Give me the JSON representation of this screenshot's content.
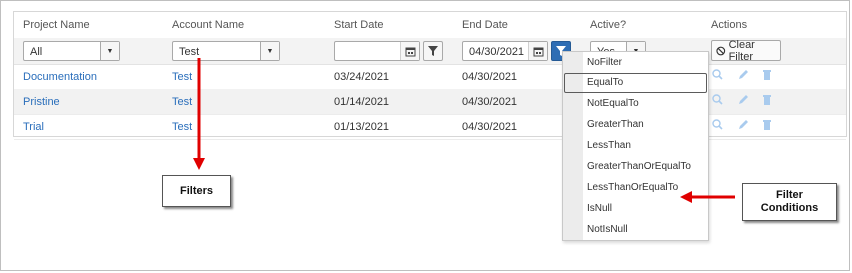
{
  "headers": {
    "project_name": "Project Name",
    "account_name": "Account Name",
    "start_date": "Start Date",
    "end_date": "End Date",
    "active": "Active?",
    "actions": "Actions"
  },
  "filters": {
    "project_value": "All",
    "account_value": "Test",
    "start_date_value": "",
    "end_date_value": "04/30/2021",
    "active_value": "Yes",
    "clear_filter_label": "Clear Filter"
  },
  "rows": [
    {
      "project": "Documentation",
      "account": "Test",
      "start": "03/24/2021",
      "end": "04/30/2021"
    },
    {
      "project": "Pristine",
      "account": "Test",
      "start": "01/14/2021",
      "end": "04/30/2021"
    },
    {
      "project": "Trial",
      "account": "Test",
      "start": "01/13/2021",
      "end": "04/30/2021"
    }
  ],
  "filter_conditions": [
    "NoFilter",
    "EqualTo",
    "NotEqualTo",
    "GreaterThan",
    "LessThan",
    "GreaterThanOrEqualTo",
    "LessThanOrEqualTo",
    "IsNull",
    "NotIsNull"
  ],
  "selected_condition": "EqualTo",
  "callouts": {
    "filters": "Filters",
    "filter_conditions_line1": "Filter",
    "filter_conditions_line2": "Conditions"
  },
  "colors": {
    "link": "#2a6ebb",
    "active_filter": "#2e6db4",
    "arrow": "#e00000",
    "action_icons": "#a9cbee"
  },
  "icons": [
    "chevron-down-icon",
    "calendar-icon",
    "filter-icon",
    "clear-filter-icon",
    "search-icon",
    "edit-icon",
    "delete-icon"
  ]
}
